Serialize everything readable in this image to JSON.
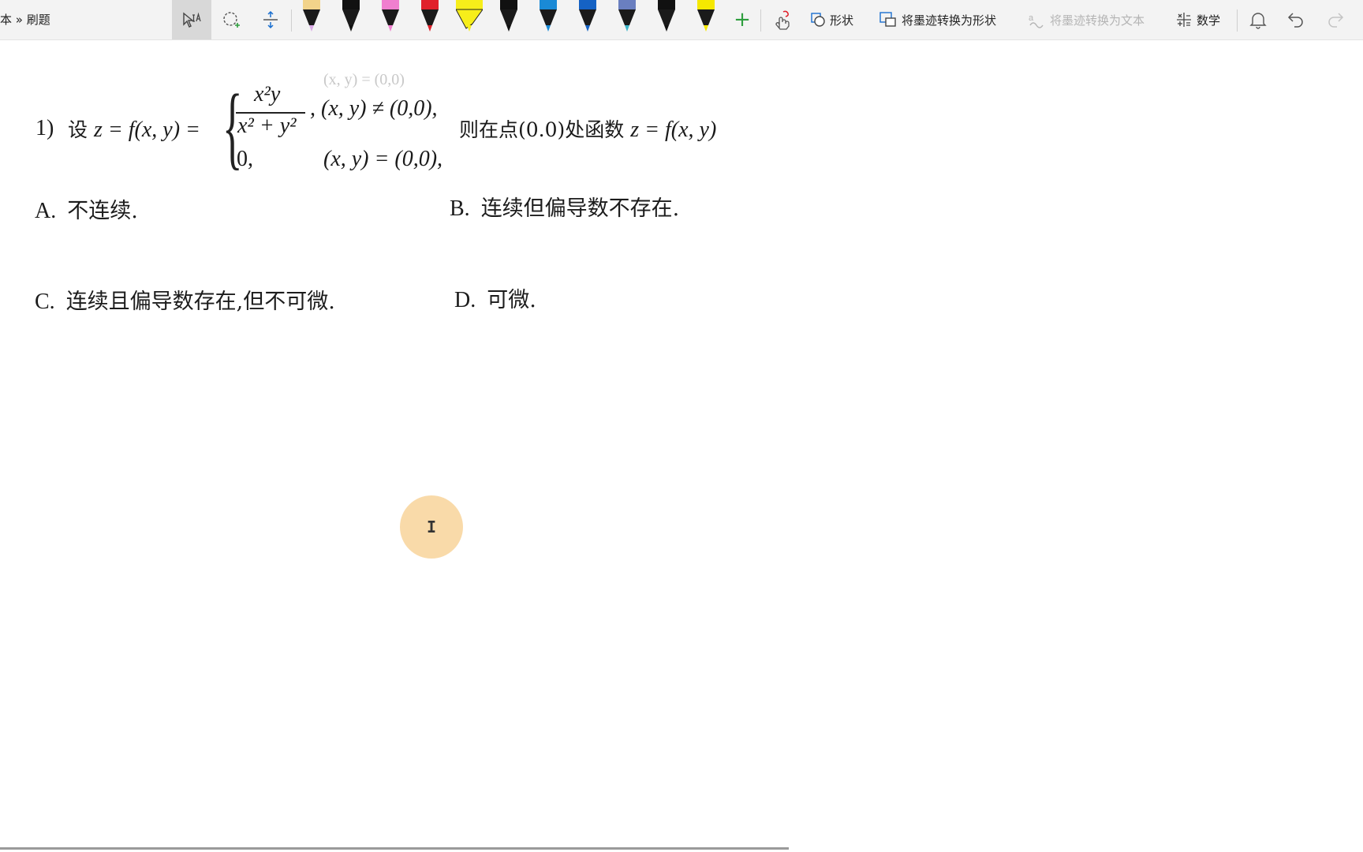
{
  "breadcrumb": "本 » 刷题",
  "toolbar": {
    "tools": [
      {
        "name": "lasso-select-text",
        "icon": "select-text-icon",
        "selected": true
      },
      {
        "name": "lasso-select",
        "icon": "lasso-add-icon",
        "selected": false
      },
      {
        "name": "add-space",
        "icon": "insert-space-icon",
        "selected": false
      }
    ],
    "pens": [
      {
        "name": "pen-peach",
        "cap": "#f2d38a",
        "tip": "#d9a8e6"
      },
      {
        "name": "pen-black-1",
        "cap": "#111111",
        "tip": "#111111"
      },
      {
        "name": "pen-pink",
        "cap": "#f07fcf",
        "tip": "#f07fcf"
      },
      {
        "name": "pen-red",
        "cap": "#e0202a",
        "tip": "#e0202a"
      },
      {
        "name": "highlighter-yellow",
        "cap": "#f7ee1a",
        "tip": "#f7ee1a"
      },
      {
        "name": "pen-black-2",
        "cap": "#111111",
        "tip": "#111111"
      },
      {
        "name": "pen-blue-1",
        "cap": "#1a8ad6",
        "tip": "#1a8ad6"
      },
      {
        "name": "pen-blue-2",
        "cap": "#1562c4",
        "tip": "#1562c4"
      },
      {
        "name": "pen-galaxy",
        "cap": "#6a7fc0",
        "tip": "#3ab5c9"
      },
      {
        "name": "pen-black-3",
        "cap": "#111111",
        "tip": "#111111"
      },
      {
        "name": "pen-yellow",
        "cap": "#f5e800",
        "tip": "#f5e800"
      }
    ],
    "add_pen": "+",
    "commands": {
      "shapes": "形状",
      "ink_to_shape": "将墨迹转换为形状",
      "ink_to_text": "将墨迹转换为文本",
      "math": "数学"
    }
  },
  "question": {
    "number": "1)",
    "lead": "设",
    "func_def": "z = f(x, y) =",
    "frac_num": "x²y",
    "frac_den": "x² + y²",
    "case1_cond": ", (x, y) ≠ (0,0),",
    "case2_value": "0,",
    "case2_cond": "(x, y) = (0,0),",
    "tail_text": "则在点(0.0)处函数",
    "tail_math": "z = f(x, y)"
  },
  "options": [
    {
      "label": "A.",
      "text": "不连续."
    },
    {
      "label": "B.",
      "text": "连续但偏导数不存在."
    },
    {
      "label": "C.",
      "text": "连续且偏导数存在,但不可微."
    },
    {
      "label": "D.",
      "text": "可微."
    }
  ],
  "colors": {
    "ribbon_bg": "#f3f3f3",
    "selected_tool_bg": "#d8d8d8",
    "cursor_halo": "#f7cd8c",
    "add_pen_green": "#2e9e3e"
  }
}
